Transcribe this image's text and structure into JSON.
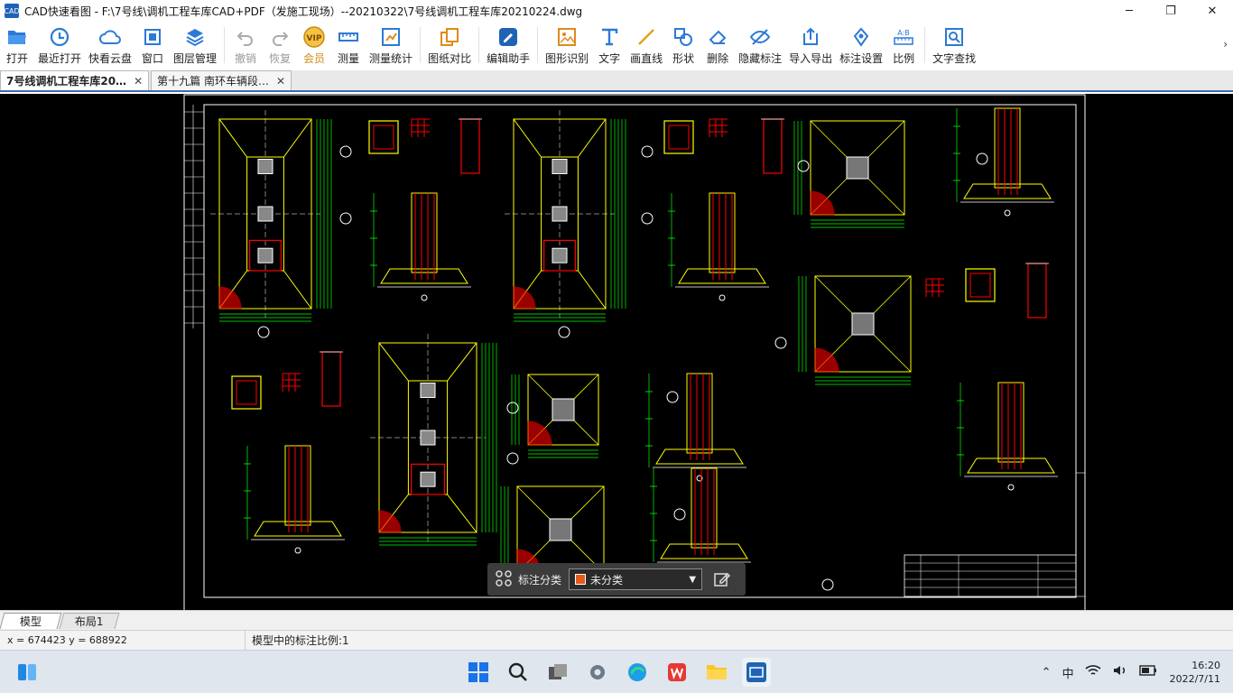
{
  "window": {
    "app_icon_text": "CAD",
    "title": "CAD快速看图 - F:\\7号线\\调机工程车库CAD+PDF（发施工现场）--20210322\\7号线调机工程车库20210224.dwg"
  },
  "toolbar": {
    "open": "打开",
    "recent": "最近打开",
    "cloud": "快看云盘",
    "window": "窗口",
    "layers": "图层管理",
    "undo": "撤销",
    "redo": "恢复",
    "vip": "会员",
    "vip_badge": "VIP",
    "measure": "测量",
    "measure_stats": "测量统计",
    "compare": "图纸对比",
    "edit_assist": "编辑助手",
    "shape_recognition": "图形识别",
    "text": "文字",
    "line": "画直线",
    "shape": "形状",
    "delete": "删除",
    "hide_annotation": "隐藏标注",
    "import_export": "导入导出",
    "annotation_settings": "标注设置",
    "scale": "比例",
    "text_search": "文字查找"
  },
  "tabs": [
    {
      "label": "7号线调机工程车库20…",
      "close": "✕"
    },
    {
      "label": "第十九篇 南环车辆段…",
      "close": "✕"
    }
  ],
  "annotation_bar": {
    "label": "标注分类",
    "selected": "未分类",
    "swatch_color": "#e55a1c"
  },
  "layout_tabs": {
    "model": "模型",
    "layout1": "布局1"
  },
  "status": {
    "coords": "x = 674423  y = 688922",
    "scale_text": "模型中的标注比例:1"
  },
  "taskbar": {
    "ime": "中",
    "time": "16:20",
    "date": "2022/7/11"
  },
  "colors": {
    "accent": "#1f63b5",
    "cad_yellow": "#ffff00",
    "cad_green": "#00ff00",
    "cad_red": "#ff0000",
    "cad_white": "#ffffff"
  }
}
